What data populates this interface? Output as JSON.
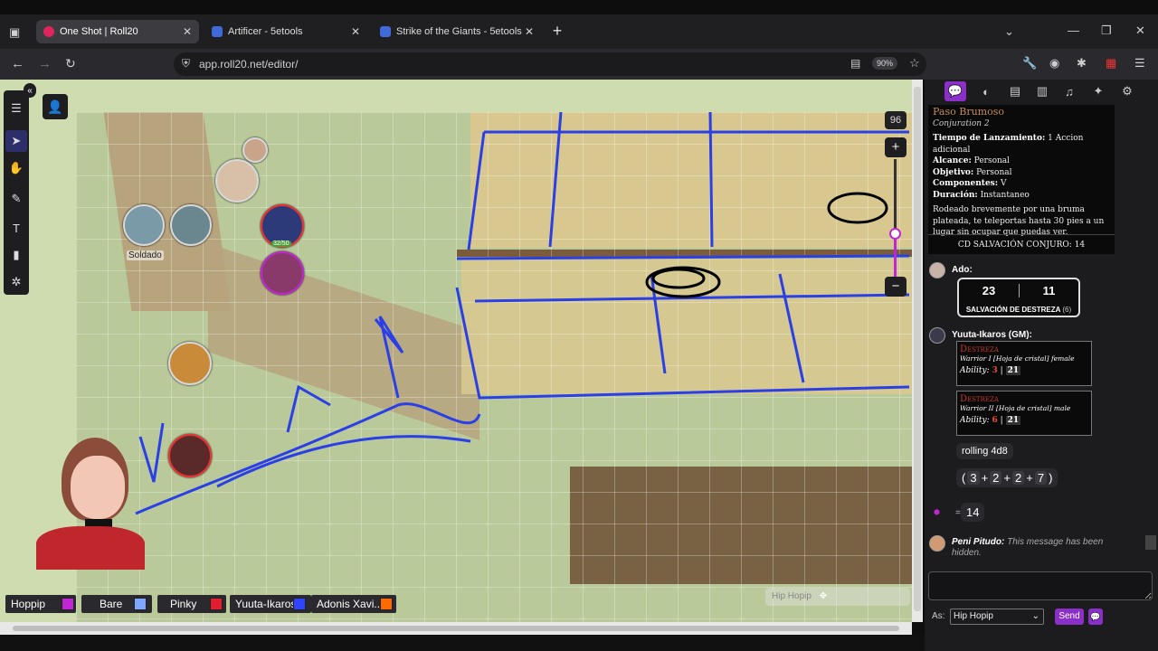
{
  "browser": {
    "tabs": [
      {
        "title": "One Shot | Roll20",
        "active": true,
        "favicon_color": "#e0245e"
      },
      {
        "title": "Artificer - 5etools",
        "active": false,
        "favicon_color": "#3f6ad8"
      },
      {
        "title": "Strike of the Giants - 5etools",
        "active": false,
        "favicon_color": "#3f6ad8"
      }
    ],
    "url": "app.roll20.net/editor/",
    "zoom": "90%",
    "new_tab": "+"
  },
  "map": {
    "zoom_value": "96",
    "zoom_in": "+",
    "zoom_out": "−",
    "token_label": "Soldado",
    "token_hp": "32/50",
    "floating_name": "Hip Hopip"
  },
  "players": [
    {
      "name": "Hoppip",
      "color": "#c026d3"
    },
    {
      "name": "Bare",
      "color": "#7ea7ff"
    },
    {
      "name": "Pinky",
      "color": "#e11d2f"
    },
    {
      "name": "Yuuta-Ikaros",
      "color": "#2f44ff"
    },
    {
      "name": "Adonis Xavi...",
      "color": "#ff6a00"
    }
  ],
  "spell": {
    "name": "Paso Brumoso",
    "school": "Conjuration 2",
    "casting_time_label": "Tiempo de Lanzamiento:",
    "casting_time": "1 Accion adicional",
    "range_label": "Alcance:",
    "range": "Personal",
    "target_label": "Objetivo:",
    "target": "Personal",
    "components_label": "Componentes:",
    "components": "V",
    "duration_label": "Duración:",
    "duration": "Instantaneo",
    "description": "Rodeado brevemente por una bruma plateada, te teleportas hasta 30 pies a un lugar sin ocupar que puedas ver.",
    "dc": "CD SALVACIÓN CONJURO: 14"
  },
  "chat": {
    "ado": {
      "name": "Ado:",
      "roll1": "23",
      "roll2": "11",
      "label": "SALVACIÓN DE DESTREZA",
      "mod": "(6)"
    },
    "gm": {
      "name": "Yuuta-Ikaros (GM):",
      "card1": {
        "title": "Destreza",
        "subtitle": "Warrior I [Hoja de cristal] female",
        "ability": "Ability:",
        "r1": "3",
        "sep": "|",
        "r2": "21"
      },
      "card2": {
        "title": "Destreza",
        "subtitle": "Warrior II [Hoja de cristal] male",
        "ability": "Ability:",
        "r1": "6",
        "sep": "|",
        "r2": "21"
      },
      "rolling": "rolling 4d8",
      "dice": [
        "3",
        "2",
        "2",
        "7"
      ],
      "result_prefix": "=",
      "result": "14"
    },
    "peni": {
      "name": "Peni Pitudo:",
      "text": "This message has been hidden."
    },
    "as_label": "As:",
    "as_value": "Hip Hopip",
    "send": "Send"
  }
}
